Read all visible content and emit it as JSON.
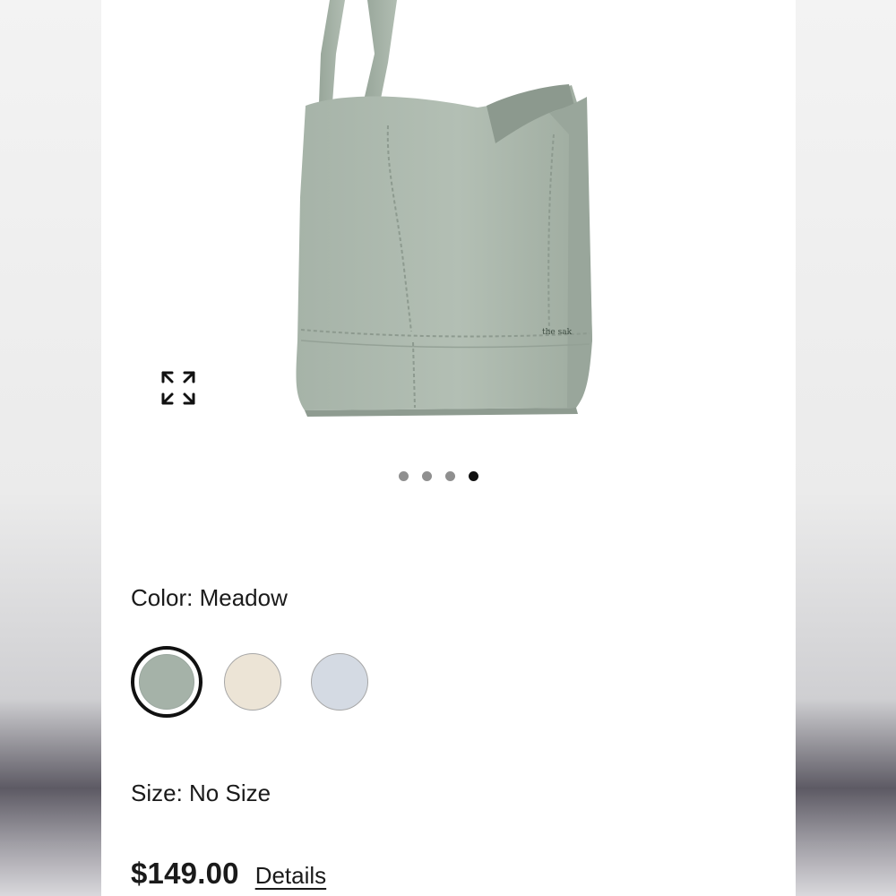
{
  "product": {
    "image_alt": "Meadow leather hobo shoulder bag",
    "brand_mark": "the sak",
    "carousel": {
      "total": 4,
      "active_index": 3
    },
    "color_label": "Color: Meadow",
    "swatches": [
      {
        "name": "Meadow",
        "color": "#a5b2a8",
        "selected": true
      },
      {
        "name": "Cream",
        "color": "#ece4d6",
        "selected": false
      },
      {
        "name": "Light Blue",
        "color": "#d4dae3",
        "selected": false
      }
    ],
    "size_label": "Size: No Size",
    "price": "$149.00",
    "details_label": "Details"
  },
  "icons": {
    "expand": "expand-arrows-icon"
  },
  "colors": {
    "accent": "#111111",
    "dot_inactive": "#8f8f8f",
    "bag": "#a8b5aa"
  }
}
